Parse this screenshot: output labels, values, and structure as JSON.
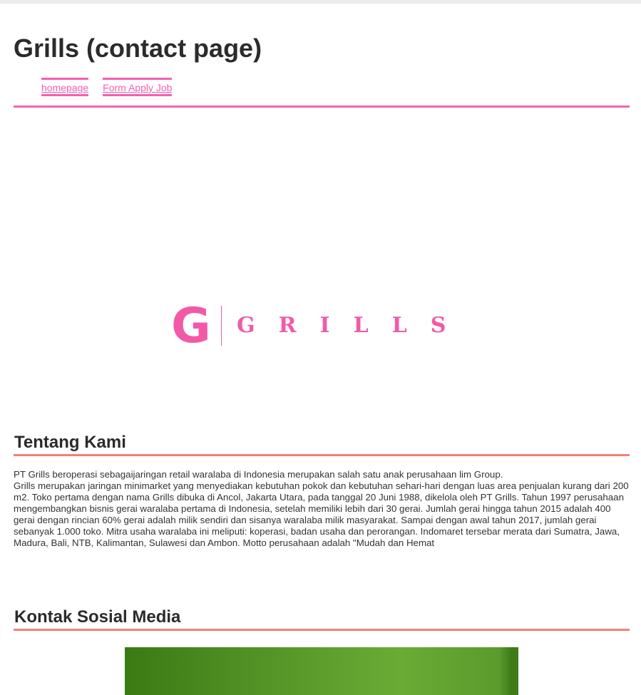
{
  "header": {
    "title": "Grills (contact page)"
  },
  "nav": {
    "items": [
      {
        "label": "homepage"
      },
      {
        "label": "Form Apply Job"
      }
    ]
  },
  "logo": {
    "letter": "G",
    "wordmark": "GRILLS",
    "color": "#f25aa7"
  },
  "about": {
    "heading": "Tentang Kami",
    "line1": "PT Grills beroperasi sebagaijaringan retail waralaba di Indonesia merupakan salah satu anak perusahaan lim Group.",
    "body": "Grills merupakan jaringan minimarket yang menyediakan kebutuhan pokok dan kebutuhan sehari-hari dengan luas area penjualan kurang dari 200 m2. Toko pertama dengan nama Grills dibuka di Ancol, Jakarta Utara, pada tanggal 20 Juni 1988, dikelola oleh PT Grills. Tahun 1997 perusahaan mengembangkan bisnis gerai waralaba pertama di Indonesia, setelah memiliki lebih dari 30 gerai. Jumlah gerai hingga tahun 2015 adalah 400 gerai dengan rincian 60% gerai adalah milik sendiri dan sisanya waralaba milik masyarakat. Sampai dengan awal tahun 2017, jumlah gerai sebanyak 1.000 toko. Mitra usaha waralaba ini meliputi: koperasi, badan usaha dan perorangan. Indomaret tersebar merata dari Sumatra, Jawa, Madura, Bali, NTB, Kalimantan, Sulawesi dan Ambon. Motto perusahaan adalah \"Mudah dan Hemat"
  },
  "social": {
    "heading": "Kontak Sosial Media"
  },
  "colors": {
    "accent_pink": "#f464ae",
    "accent_salmon": "#f08079"
  }
}
